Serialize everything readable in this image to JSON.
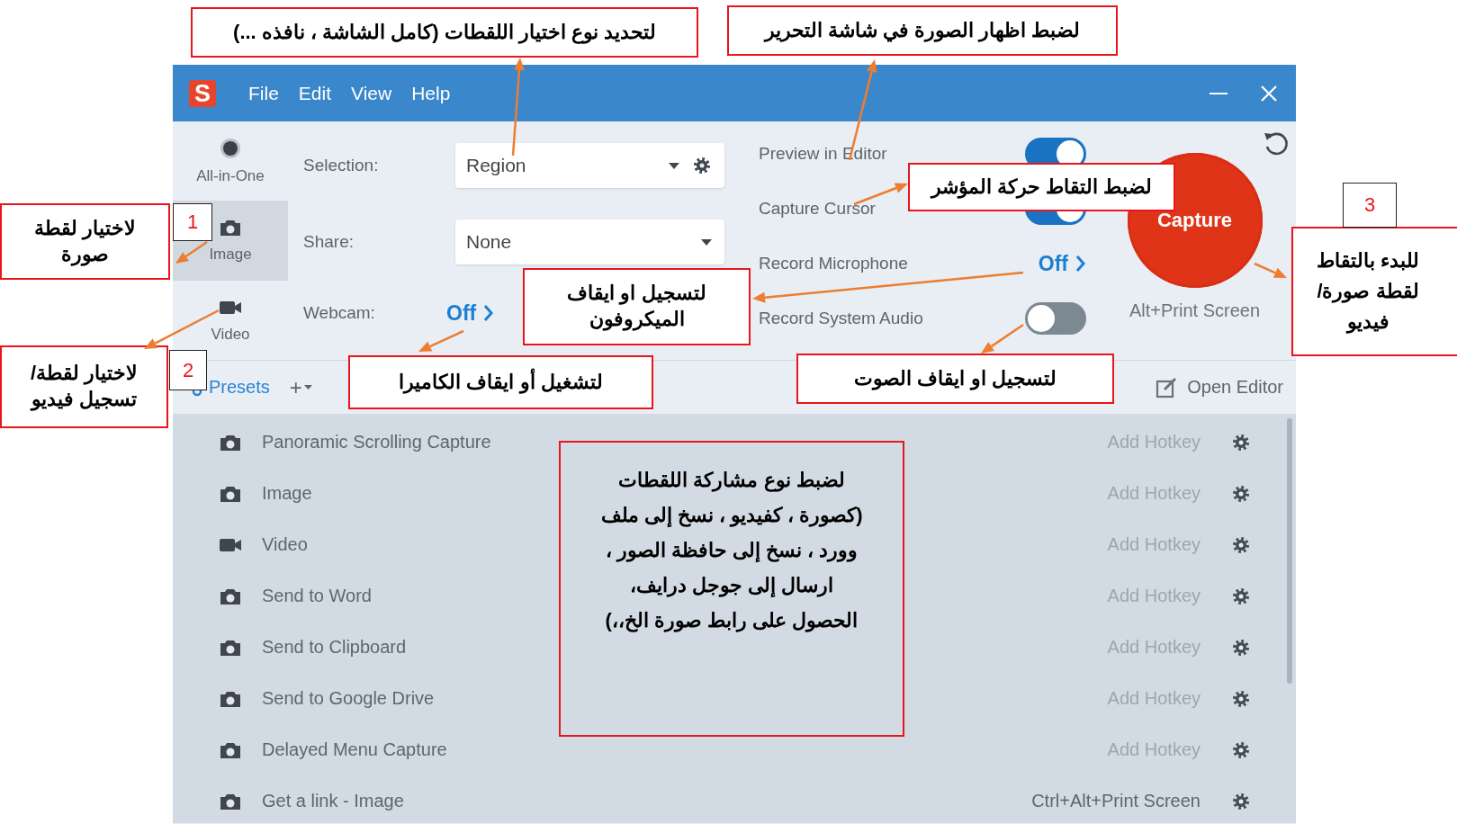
{
  "window": {
    "logo": "S",
    "menu": {
      "file": "File",
      "edit": "Edit",
      "view": "View",
      "help": "Help"
    }
  },
  "sidebar": {
    "items": [
      {
        "label": "All-in-One",
        "kind": "record",
        "selected": false
      },
      {
        "label": "Image",
        "kind": "camera",
        "selected": true
      },
      {
        "label": "Video",
        "kind": "video",
        "selected": false
      }
    ]
  },
  "settings": [
    {
      "label": "Selection:",
      "kind": "dropdown-gear",
      "value": "Region"
    },
    {
      "label": "Share:",
      "kind": "dropdown",
      "value": "None"
    },
    {
      "label": "Webcam:",
      "kind": "link",
      "value": "Off"
    }
  ],
  "options": [
    {
      "label": "Preview in Editor",
      "kind": "toggle",
      "on": true
    },
    {
      "label": "Capture Cursor",
      "kind": "toggle",
      "on": true
    },
    {
      "label": "Record Microphone",
      "kind": "link",
      "value": "Off"
    },
    {
      "label": "Record System Audio",
      "kind": "toggle",
      "on": false
    }
  ],
  "capture": {
    "label": "Capture",
    "hotkey": "Alt+Print Screen"
  },
  "presets": {
    "label": "Presets",
    "add": "+"
  },
  "open_editor": "Open Editor",
  "preset_list": [
    {
      "name": "Panoramic Scrolling Capture",
      "kind": "image",
      "hotkey": "Add Hotkey",
      "assigned": false
    },
    {
      "name": "Image",
      "kind": "image",
      "hotkey": "Add Hotkey",
      "assigned": false
    },
    {
      "name": "Video",
      "kind": "video",
      "hotkey": "Add Hotkey",
      "assigned": false
    },
    {
      "name": "Send to Word",
      "kind": "image",
      "hotkey": "Add Hotkey",
      "assigned": false
    },
    {
      "name": "Send to Clipboard",
      "kind": "image",
      "hotkey": "Add Hotkey",
      "assigned": false
    },
    {
      "name": "Send to Google Drive",
      "kind": "image",
      "hotkey": "Add Hotkey",
      "assigned": false
    },
    {
      "name": "Delayed Menu Capture",
      "kind": "image",
      "hotkey": "Add Hotkey",
      "assigned": false
    },
    {
      "name": "Get a link - Image",
      "kind": "image",
      "hotkey": "Ctrl+Alt+Print Screen",
      "assigned": true
    }
  ],
  "annotations": [
    {
      "text": "لضبط اظهار الصورة في شاشة التحرير"
    },
    {
      "text": "لتحديد نوع اختيار اللقطات (كامل الشاشة ، نافذه ...)"
    },
    {
      "text": "لضبط التقاط حركة المؤشر"
    },
    {
      "text": "لاختيار لقطة صورة",
      "marker": "1"
    },
    {
      "text": "لاختيار لقطة/ تسجيل فيديو",
      "marker": "2"
    },
    {
      "text": "لتسجيل او ايقاف الميكروفون"
    },
    {
      "text": "لتسجيل او ايقاف الصوت"
    },
    {
      "text": "لتشغيل أو ايقاف الكاميرا"
    },
    {
      "text": "للبدء بالتقاط لقطة صورة/ فيديو",
      "marker": "3"
    },
    {
      "text": "لضبط نوع مشاركة اللقطات (كصورة ، كفيديو ، نسخ إلى ملف وورد ، نسخ إلى حافظة الصور ، ارسال إلى جوجل درايف، الحصول على رابط صورة الخ،،)"
    }
  ]
}
